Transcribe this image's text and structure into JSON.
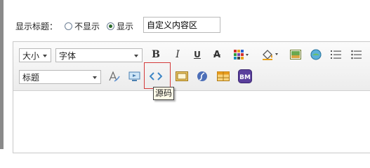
{
  "title_setting": {
    "label": "显示标题：",
    "options": [
      {
        "label": "不显示",
        "checked": false
      },
      {
        "label": "显示",
        "checked": true
      }
    ],
    "input_value": "自定义内容区"
  },
  "toolbar": {
    "size_select": "大小",
    "font_select": "字体",
    "heading_select": "标题",
    "bold": "B",
    "italic": "I",
    "underline": "U",
    "strikethrough": "A",
    "source_tooltip": "源码"
  },
  "icons": [
    "font-size-select",
    "font-family-select",
    "bold-icon",
    "italic-icon",
    "underline-icon",
    "strikethrough-icon",
    "text-color-icon",
    "fill-color-icon",
    "image-icon",
    "emoticon-icon",
    "ordered-list-icon",
    "unordered-list-icon",
    "heading-select",
    "clear-format-icon",
    "media-icon",
    "source-code-icon",
    "frame-icon",
    "flash-icon",
    "table-icon",
    "bm-icon"
  ],
  "colors": {
    "source_highlight": "#d43a3a",
    "radio_checked": "#2a6b2a"
  }
}
